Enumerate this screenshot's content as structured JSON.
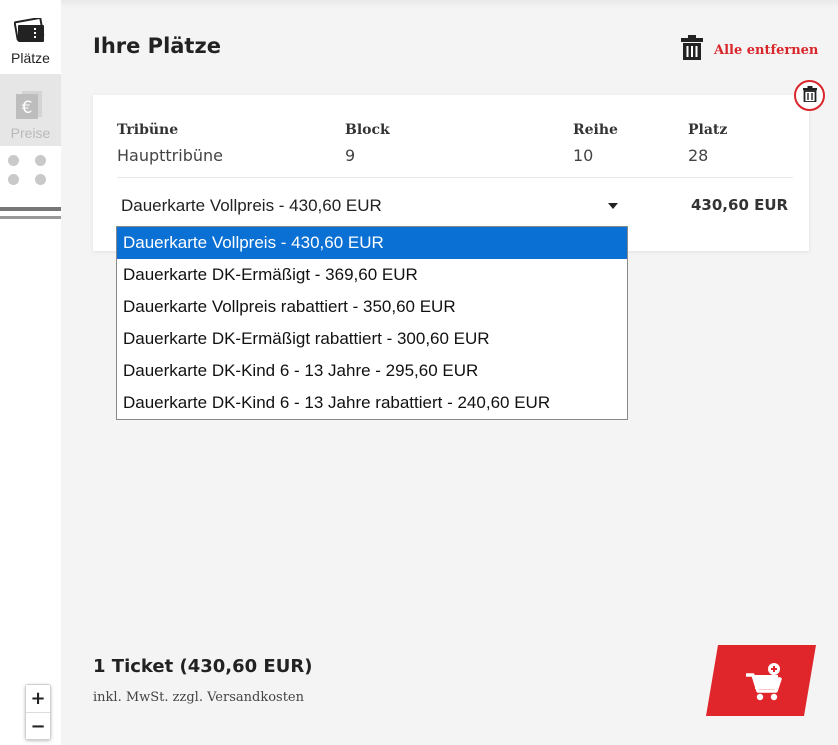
{
  "sidebar": {
    "tabs": [
      {
        "label": "Plätze",
        "icon": "ticket-icon",
        "active": true
      },
      {
        "label": "Preise",
        "icon": "euro-icon",
        "active": false
      }
    ]
  },
  "zoom": {
    "plus": "+",
    "minus": "−"
  },
  "header": {
    "title": "Ihre Plätze",
    "remove_all_label": "Alle entfernen"
  },
  "seat": {
    "columns": [
      {
        "label": "Tribüne",
        "value": "Haupttribüne"
      },
      {
        "label": "Block",
        "value": "9"
      },
      {
        "label": "Reihe",
        "value": "10"
      },
      {
        "label": "Platz",
        "value": "28"
      }
    ],
    "selected_price_option": "Dauerkarte Vollpreis - 430,60 EUR",
    "price": "430,60 EUR",
    "options": [
      "Dauerkarte Vollpreis - 430,60 EUR",
      "Dauerkarte DK-Ermäßigt - 369,60 EUR",
      "Dauerkarte Vollpreis rabattiert - 350,60 EUR",
      "Dauerkarte DK-Ermäßigt rabattiert - 300,60 EUR",
      "Dauerkarte DK-Kind 6 - 13 Jahre - 295,60 EUR",
      "Dauerkarte DK-Kind 6 - 13 Jahre rabattiert - 240,60 EUR"
    ],
    "highlighted_option_index": 0
  },
  "footer": {
    "summary": "1 Ticket (430,60 EUR)",
    "tax_note": "inkl. MwSt. zzgl. Versandkosten"
  },
  "colors": {
    "accent": "#d9262b",
    "highlight": "#0a70d4",
    "background": "#f4f4f4"
  }
}
